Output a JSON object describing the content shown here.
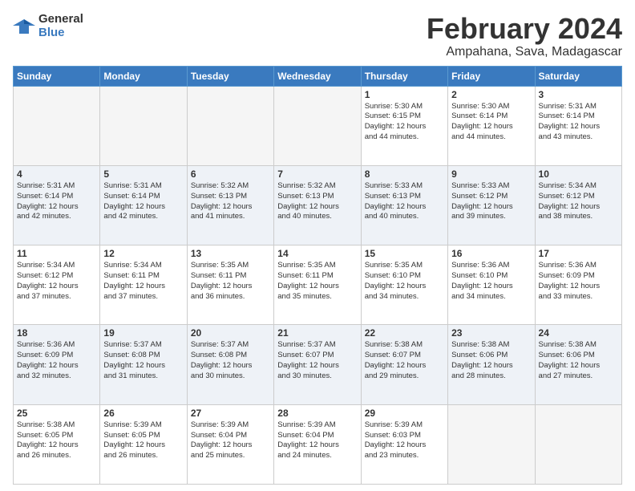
{
  "logo": {
    "general": "General",
    "blue": "Blue"
  },
  "title": "February 2024",
  "location": "Ampahana, Sava, Madagascar",
  "headers": [
    "Sunday",
    "Monday",
    "Tuesday",
    "Wednesday",
    "Thursday",
    "Friday",
    "Saturday"
  ],
  "rows": [
    [
      {
        "day": "",
        "info": ""
      },
      {
        "day": "",
        "info": ""
      },
      {
        "day": "",
        "info": ""
      },
      {
        "day": "",
        "info": ""
      },
      {
        "day": "1",
        "info": "Sunrise: 5:30 AM\nSunset: 6:15 PM\nDaylight: 12 hours\nand 44 minutes."
      },
      {
        "day": "2",
        "info": "Sunrise: 5:30 AM\nSunset: 6:14 PM\nDaylight: 12 hours\nand 44 minutes."
      },
      {
        "day": "3",
        "info": "Sunrise: 5:31 AM\nSunset: 6:14 PM\nDaylight: 12 hours\nand 43 minutes."
      }
    ],
    [
      {
        "day": "4",
        "info": "Sunrise: 5:31 AM\nSunset: 6:14 PM\nDaylight: 12 hours\nand 42 minutes."
      },
      {
        "day": "5",
        "info": "Sunrise: 5:31 AM\nSunset: 6:14 PM\nDaylight: 12 hours\nand 42 minutes."
      },
      {
        "day": "6",
        "info": "Sunrise: 5:32 AM\nSunset: 6:13 PM\nDaylight: 12 hours\nand 41 minutes."
      },
      {
        "day": "7",
        "info": "Sunrise: 5:32 AM\nSunset: 6:13 PM\nDaylight: 12 hours\nand 40 minutes."
      },
      {
        "day": "8",
        "info": "Sunrise: 5:33 AM\nSunset: 6:13 PM\nDaylight: 12 hours\nand 40 minutes."
      },
      {
        "day": "9",
        "info": "Sunrise: 5:33 AM\nSunset: 6:12 PM\nDaylight: 12 hours\nand 39 minutes."
      },
      {
        "day": "10",
        "info": "Sunrise: 5:34 AM\nSunset: 6:12 PM\nDaylight: 12 hours\nand 38 minutes."
      }
    ],
    [
      {
        "day": "11",
        "info": "Sunrise: 5:34 AM\nSunset: 6:12 PM\nDaylight: 12 hours\nand 37 minutes."
      },
      {
        "day": "12",
        "info": "Sunrise: 5:34 AM\nSunset: 6:11 PM\nDaylight: 12 hours\nand 37 minutes."
      },
      {
        "day": "13",
        "info": "Sunrise: 5:35 AM\nSunset: 6:11 PM\nDaylight: 12 hours\nand 36 minutes."
      },
      {
        "day": "14",
        "info": "Sunrise: 5:35 AM\nSunset: 6:11 PM\nDaylight: 12 hours\nand 35 minutes."
      },
      {
        "day": "15",
        "info": "Sunrise: 5:35 AM\nSunset: 6:10 PM\nDaylight: 12 hours\nand 34 minutes."
      },
      {
        "day": "16",
        "info": "Sunrise: 5:36 AM\nSunset: 6:10 PM\nDaylight: 12 hours\nand 34 minutes."
      },
      {
        "day": "17",
        "info": "Sunrise: 5:36 AM\nSunset: 6:09 PM\nDaylight: 12 hours\nand 33 minutes."
      }
    ],
    [
      {
        "day": "18",
        "info": "Sunrise: 5:36 AM\nSunset: 6:09 PM\nDaylight: 12 hours\nand 32 minutes."
      },
      {
        "day": "19",
        "info": "Sunrise: 5:37 AM\nSunset: 6:08 PM\nDaylight: 12 hours\nand 31 minutes."
      },
      {
        "day": "20",
        "info": "Sunrise: 5:37 AM\nSunset: 6:08 PM\nDaylight: 12 hours\nand 30 minutes."
      },
      {
        "day": "21",
        "info": "Sunrise: 5:37 AM\nSunset: 6:07 PM\nDaylight: 12 hours\nand 30 minutes."
      },
      {
        "day": "22",
        "info": "Sunrise: 5:38 AM\nSunset: 6:07 PM\nDaylight: 12 hours\nand 29 minutes."
      },
      {
        "day": "23",
        "info": "Sunrise: 5:38 AM\nSunset: 6:06 PM\nDaylight: 12 hours\nand 28 minutes."
      },
      {
        "day": "24",
        "info": "Sunrise: 5:38 AM\nSunset: 6:06 PM\nDaylight: 12 hours\nand 27 minutes."
      }
    ],
    [
      {
        "day": "25",
        "info": "Sunrise: 5:38 AM\nSunset: 6:05 PM\nDaylight: 12 hours\nand 26 minutes."
      },
      {
        "day": "26",
        "info": "Sunrise: 5:39 AM\nSunset: 6:05 PM\nDaylight: 12 hours\nand 26 minutes."
      },
      {
        "day": "27",
        "info": "Sunrise: 5:39 AM\nSunset: 6:04 PM\nDaylight: 12 hours\nand 25 minutes."
      },
      {
        "day": "28",
        "info": "Sunrise: 5:39 AM\nSunset: 6:04 PM\nDaylight: 12 hours\nand 24 minutes."
      },
      {
        "day": "29",
        "info": "Sunrise: 5:39 AM\nSunset: 6:03 PM\nDaylight: 12 hours\nand 23 minutes."
      },
      {
        "day": "",
        "info": ""
      },
      {
        "day": "",
        "info": ""
      }
    ]
  ]
}
